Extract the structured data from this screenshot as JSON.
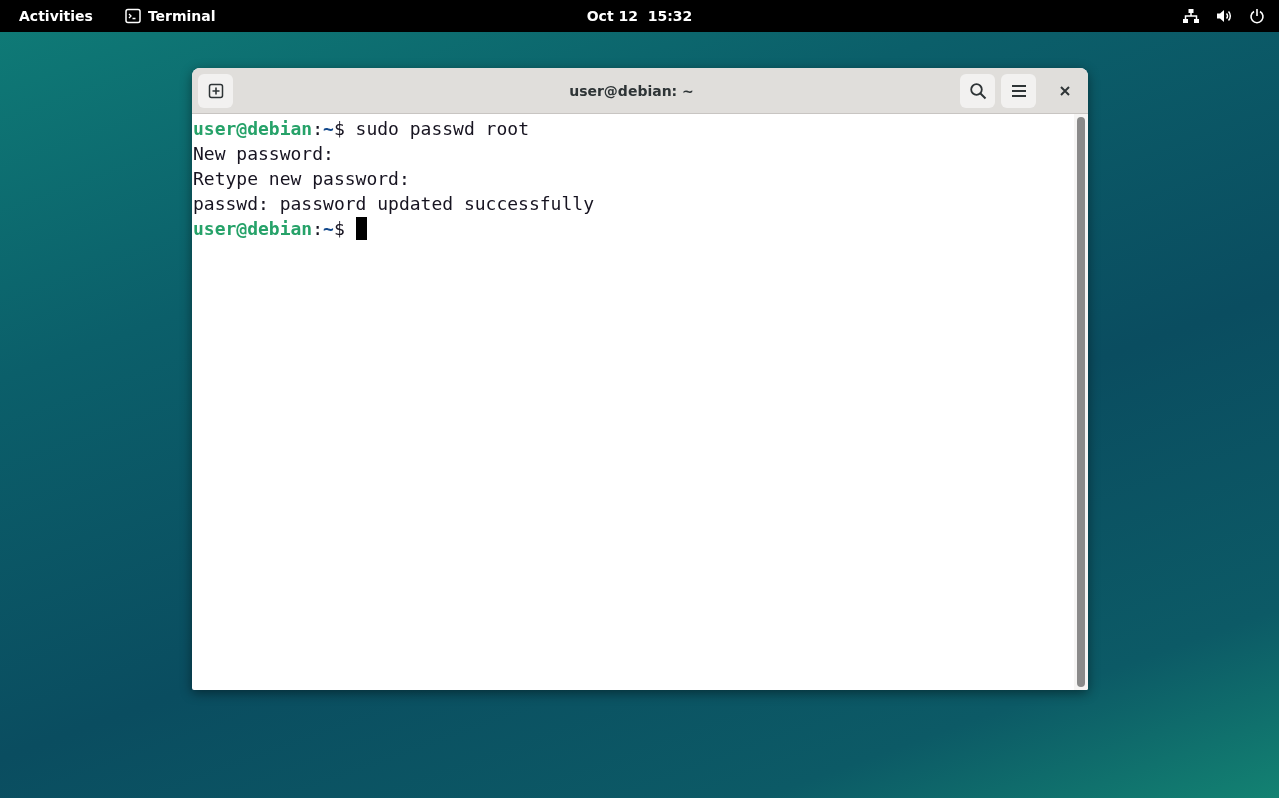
{
  "top_bar": {
    "activities": "Activities",
    "app_name": "Terminal",
    "clock": "Oct 12  15:32"
  },
  "window": {
    "title": "user@debian: ~"
  },
  "terminal": {
    "lines": [
      [
        {
          "kind": "user",
          "text": "user@debian"
        },
        {
          "kind": "plain",
          "text": ":"
        },
        {
          "kind": "path",
          "text": "~"
        },
        {
          "kind": "plain",
          "text": "$ sudo passwd root"
        }
      ],
      [
        {
          "kind": "plain",
          "text": "New password:"
        }
      ],
      [
        {
          "kind": "plain",
          "text": "Retype new password:"
        }
      ],
      [
        {
          "kind": "plain",
          "text": "passwd: password updated successfully"
        }
      ],
      [
        {
          "kind": "user",
          "text": "user@debian"
        },
        {
          "kind": "plain",
          "text": ":"
        },
        {
          "kind": "path",
          "text": "~"
        },
        {
          "kind": "plain",
          "text": "$ "
        },
        {
          "kind": "cursor"
        }
      ]
    ]
  }
}
